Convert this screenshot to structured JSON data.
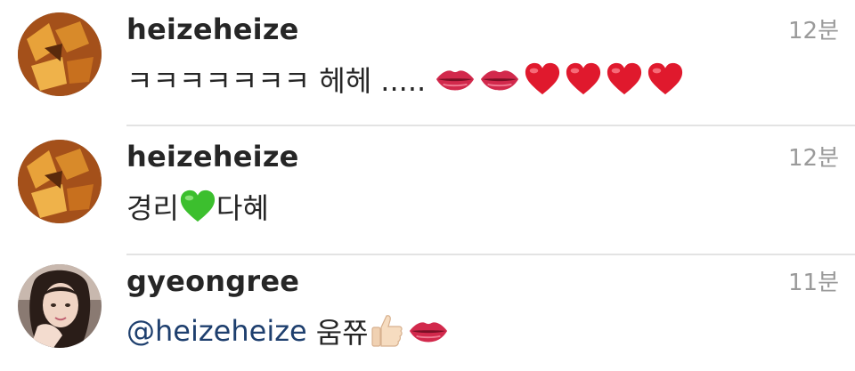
{
  "comments": [
    {
      "username": "heizeheize",
      "time": "12분",
      "text": "ㅋㅋㅋㅋㅋㅋㅋ 헤헤 .....",
      "emojis": [
        "lips-emoji",
        "lips-emoji",
        "red-heart-emoji",
        "red-heart-emoji",
        "red-heart-emoji",
        "red-heart-emoji"
      ]
    },
    {
      "username": "heizeheize",
      "time": "12분",
      "text_before": "경리",
      "text_after": "다혜",
      "emojis": [
        "green-heart-emoji"
      ]
    },
    {
      "username": "gyeongree",
      "time": "11분",
      "mention": "@heizeheize",
      "text": "움쮸",
      "emojis": [
        "thumbs-up-emoji",
        "lips-emoji"
      ]
    }
  ],
  "colors": {
    "username": "#262626",
    "timestamp": "#9a9a9a",
    "mention": "#1e3f6e",
    "divider": "#e3e3e3"
  }
}
